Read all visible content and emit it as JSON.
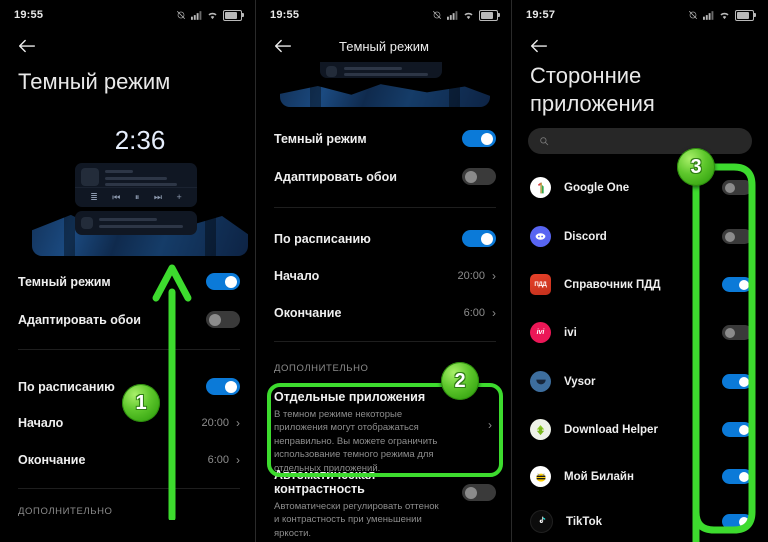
{
  "meta": {
    "accent_blue": "#0b7ad8",
    "annotation_green": "#3ddb2e",
    "background": "#000000"
  },
  "panel1": {
    "status": {
      "time": "19:55",
      "icons": [
        "alarm-off-icon",
        "signal-icon",
        "wifi-icon",
        "battery-icon"
      ]
    },
    "nav": {
      "back": "←",
      "title": ""
    },
    "title": "Темный режим",
    "preview": {
      "clock": "2:36",
      "controls": [
        "≣",
        "⏮",
        "⏸",
        "⏭",
        "+"
      ]
    },
    "rows": [
      {
        "label": "Темный режим",
        "type": "switch",
        "state": "on"
      },
      {
        "label": "Адаптировать обои",
        "type": "switch",
        "state": "off"
      },
      {
        "label": "По расписанию",
        "type": "switch",
        "state": "on"
      },
      {
        "label": "Начало",
        "type": "value",
        "value": "20:00",
        "chevron": "›"
      },
      {
        "label": "Окончание",
        "type": "value",
        "value": "6:00",
        "chevron": "›"
      }
    ],
    "section_label": "ДОПОЛНИТЕЛЬНО",
    "annotation": {
      "number": "1",
      "kind": "arrow-up"
    }
  },
  "panel2": {
    "status": {
      "time": "19:55",
      "icons": [
        "alarm-off-icon",
        "signal-icon",
        "wifi-icon",
        "battery-icon"
      ]
    },
    "nav": {
      "back": "←",
      "title": "Темный режим"
    },
    "rows": [
      {
        "label": "Темный режим",
        "type": "switch",
        "state": "on"
      },
      {
        "label": "Адаптировать обои",
        "type": "switch",
        "state": "off"
      },
      {
        "label": "По расписанию",
        "type": "switch",
        "state": "on"
      },
      {
        "label": "Начало",
        "type": "value",
        "value": "20:00",
        "chevron": "›"
      },
      {
        "label": "Окончание",
        "type": "value",
        "value": "6:00",
        "chevron": "›"
      }
    ],
    "section_label": "ДОПОЛНИТЕЛЬНО",
    "blocks": [
      {
        "title": "Отдельные приложения",
        "desc": "В темном режиме некоторые приложения могут отображаться неправильно. Вы можете ограничить использование темного режима для отдельных приложений.",
        "chevron": "›",
        "highlighted": true
      },
      {
        "title": "Автоматическая контрастность",
        "desc": "Автоматически регулировать оттенок и контрастность при уменьшении яркости.",
        "type": "switch",
        "state": "off",
        "highlighted": false
      }
    ],
    "annotation": {
      "number": "2",
      "kind": "rounded-box"
    }
  },
  "panel3": {
    "status": {
      "time": "19:57",
      "icons": [
        "alarm-off-icon",
        "signal-icon",
        "wifi-icon",
        "battery-icon"
      ]
    },
    "nav": {
      "back": "←",
      "title": ""
    },
    "title": "Сторонние приложения",
    "search": {
      "placeholder": "",
      "value": "",
      "icon": "search-icon"
    },
    "apps": [
      {
        "name": "Google One",
        "icon": "google-one-icon",
        "state": "off"
      },
      {
        "name": "Discord",
        "icon": "discord-icon",
        "state": "off"
      },
      {
        "name": "Справочник ПДД",
        "icon": "pdd-icon",
        "state": "on"
      },
      {
        "name": "ivi",
        "icon": "ivi-icon",
        "state": "off"
      },
      {
        "name": "Vysor",
        "icon": "vysor-icon",
        "state": "on"
      },
      {
        "name": "Download Helper",
        "icon": "download-helper-icon",
        "state": "on"
      },
      {
        "name": "Мой Билайн",
        "icon": "beeline-icon",
        "state": "on"
      },
      {
        "name": "TikTok",
        "icon": "tiktok-icon",
        "state": "on"
      }
    ],
    "annotation": {
      "number": "3",
      "kind": "rail-box"
    }
  }
}
